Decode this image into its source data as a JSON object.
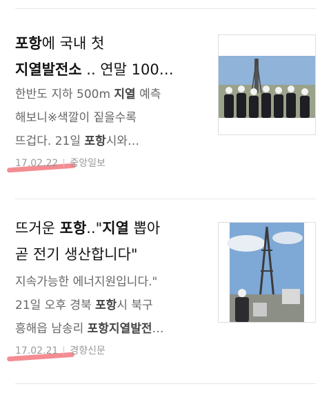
{
  "articles": [
    {
      "title": {
        "p1": "포항",
        "p2": "에 국내 첫",
        "p3": "지열발전소",
        "p4": " .. 연말 100…"
      },
      "snippet": {
        "a": "한반도 지하 500m ",
        "b": "지열",
        "c": " 예측",
        "d": "해보니※색깔이 짙을수록",
        "e": "뜨겁다. 21일 ",
        "f": "포항",
        "g": "시와…"
      },
      "date": "17.02.22",
      "source": "중앙일보",
      "image_icon": "geothermal-plant-photo"
    },
    {
      "title": {
        "p1": "뜨거운 ",
        "p2": "포항",
        "p3": "..\"",
        "p4": "지열",
        "p5": " 뽑아",
        "p6": "곧 전기 생산합니다\""
      },
      "snippet": {
        "a": "지속가능한 에너지원입니다.\"",
        "b": "21일 오후 경북 ",
        "c": "포항",
        "d": "시 북구",
        "e": "흥해읍 남송리 ",
        "f": "포항지열발전",
        "g": "…"
      },
      "date": "17.02.21",
      "source": "경향신문",
      "image_icon": "drilling-rig-photo"
    }
  ],
  "colors": {
    "highlight": "#f2787f",
    "meta": "#999999"
  }
}
